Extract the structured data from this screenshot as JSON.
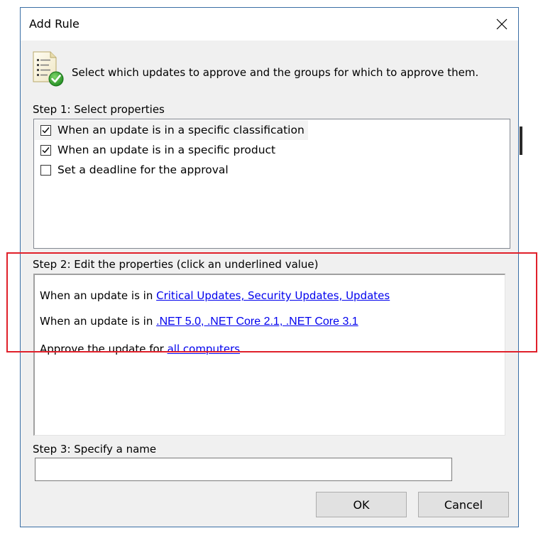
{
  "window": {
    "title": "Add Rule"
  },
  "header": {
    "text": "Select which updates to approve and the groups for which to approve them."
  },
  "step1": {
    "label": "Step 1: Select properties",
    "items": [
      {
        "label": "When an update is in a specific classification",
        "checked": true
      },
      {
        "label": "When an update is in a specific product",
        "checked": true
      },
      {
        "label": "Set a deadline for the approval",
        "checked": false
      }
    ]
  },
  "step2": {
    "label": "Step 2: Edit the properties (click an underlined value)",
    "lines": [
      {
        "prefix": "When an update is in ",
        "link": "Critical Updates, Security Updates, Updates"
      },
      {
        "prefix": "When an update is in ",
        "link": ".NET 5.0, .NET Core 2.1, .NET Core 3.1"
      },
      {
        "prefix": "Approve the update for ",
        "link": "all computers"
      }
    ]
  },
  "step3": {
    "label": "Step 3: Specify a name",
    "value": ""
  },
  "buttons": {
    "ok": "OK",
    "cancel": "Cancel"
  },
  "colors": {
    "link": "#0000ee",
    "highlight_frame": "#e0202a",
    "window_border": "#3a6ea5"
  }
}
